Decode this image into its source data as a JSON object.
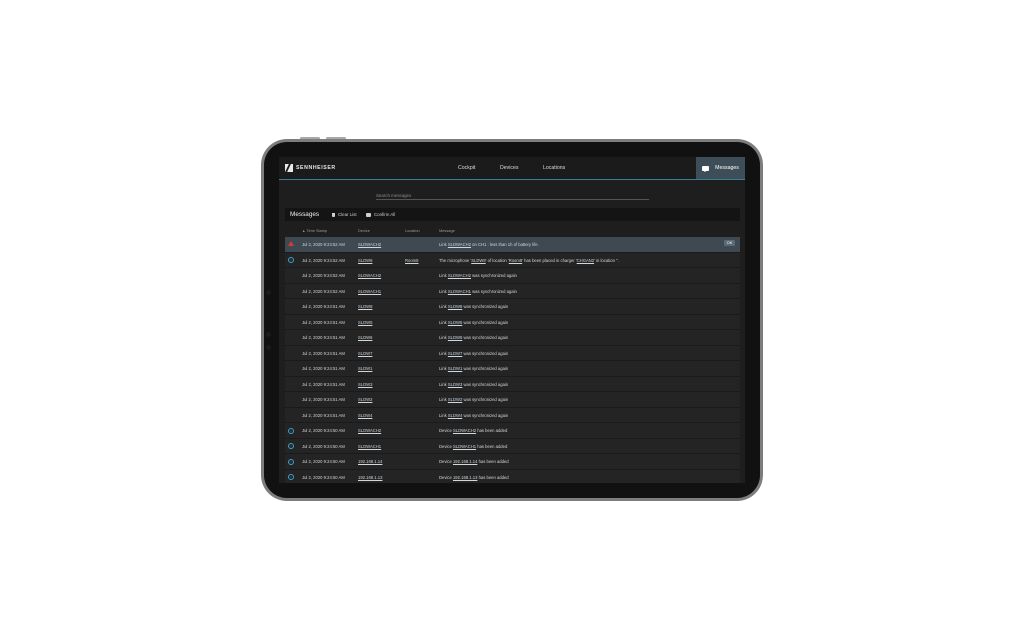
{
  "app": {
    "brand": "SENNHEISER",
    "nav": [
      "Cockpit",
      "Devices",
      "Locations"
    ],
    "messages_nav": "Messages"
  },
  "search": {
    "placeholder": "Search messages"
  },
  "panel": {
    "title": "Messages",
    "clear_label": "Clear List",
    "confirm_label": "Confirm All",
    "columns": {
      "timestamp": "Time Stamp",
      "device": "Device",
      "location": "Location",
      "message": "Message"
    },
    "ok_label": "OK"
  },
  "rows": [
    {
      "icon": "warning",
      "time": "Jul 2, 2020 9:24:52 AM",
      "device": "SLDWACH2",
      "location": "",
      "msg": [
        {
          "t": "Link "
        },
        {
          "t": "SLDWACH2",
          "link": true
        },
        {
          "t": " on CH1 : less than 1h of battery life."
        }
      ]
    },
    {
      "icon": "info",
      "time": "Jul 2, 2020 9:24:52 AM",
      "device": "SLDW8",
      "location": "Room8",
      "msg": [
        {
          "t": "The microphone '"
        },
        {
          "t": "SLDW8",
          "link": true
        },
        {
          "t": "' of location '"
        },
        {
          "t": "Room8",
          "link": true
        },
        {
          "t": "' has been placed in charger '"
        },
        {
          "t": "CHGAN2",
          "link": true
        },
        {
          "t": "' in location ''."
        }
      ]
    },
    {
      "icon": "",
      "time": "Jul 2, 2020 9:24:52 AM",
      "device": "SLDWACH2",
      "location": "",
      "msg": [
        {
          "t": "Link "
        },
        {
          "t": "SLDWACH2",
          "link": true
        },
        {
          "t": " was synchronized again"
        }
      ]
    },
    {
      "icon": "",
      "time": "Jul 2, 2020 9:24:52 AM",
      "device": "SLDWACH1",
      "location": "",
      "msg": [
        {
          "t": "Link "
        },
        {
          "t": "SLDWACH1",
          "link": true
        },
        {
          "t": " was synchronized again"
        }
      ]
    },
    {
      "icon": "",
      "time": "Jul 2, 2020 9:24:51 AM",
      "device": "SLDW8",
      "location": "",
      "msg": [
        {
          "t": "Link "
        },
        {
          "t": "SLDW8",
          "link": true
        },
        {
          "t": " was synchronized again"
        }
      ]
    },
    {
      "icon": "",
      "time": "Jul 2, 2020 9:24:51 AM",
      "device": "SLDW5",
      "location": "",
      "msg": [
        {
          "t": "Link "
        },
        {
          "t": "SLDW5",
          "link": true
        },
        {
          "t": " was synchronized again"
        }
      ]
    },
    {
      "icon": "",
      "time": "Jul 2, 2020 9:24:51 AM",
      "device": "SLDW6",
      "location": "",
      "msg": [
        {
          "t": "Link "
        },
        {
          "t": "SLDW6",
          "link": true
        },
        {
          "t": " was synchronized again"
        }
      ]
    },
    {
      "icon": "",
      "time": "Jul 2, 2020 9:24:51 AM",
      "device": "SLDW7",
      "location": "",
      "msg": [
        {
          "t": "Link "
        },
        {
          "t": "SLDW7",
          "link": true
        },
        {
          "t": " was synchronized again"
        }
      ]
    },
    {
      "icon": "",
      "time": "Jul 2, 2020 9:24:51 AM",
      "device": "SLDW1",
      "location": "",
      "msg": [
        {
          "t": "Link "
        },
        {
          "t": "SLDW1",
          "link": true
        },
        {
          "t": " was synchronized again"
        }
      ]
    },
    {
      "icon": "",
      "time": "Jul 2, 2020 9:24:51 AM",
      "device": "SLDW3",
      "location": "",
      "msg": [
        {
          "t": "Link "
        },
        {
          "t": "SLDW3",
          "link": true
        },
        {
          "t": " was synchronized again"
        }
      ]
    },
    {
      "icon": "",
      "time": "Jul 2, 2020 9:24:51 AM",
      "device": "SLDW2",
      "location": "",
      "msg": [
        {
          "t": "Link "
        },
        {
          "t": "SLDW2",
          "link": true
        },
        {
          "t": " was synchronized again"
        }
      ]
    },
    {
      "icon": "",
      "time": "Jul 2, 2020 9:24:51 AM",
      "device": "SLDW4",
      "location": "",
      "msg": [
        {
          "t": "Link "
        },
        {
          "t": "SLDW4",
          "link": true
        },
        {
          "t": " was synchronized again"
        }
      ]
    },
    {
      "icon": "info",
      "time": "Jul 2, 2020 9:24:50 AM",
      "device": "SLDWACH2",
      "location": "",
      "msg": [
        {
          "t": "Device "
        },
        {
          "t": "SLDWACH2",
          "link": true
        },
        {
          "t": " has been added"
        }
      ]
    },
    {
      "icon": "info",
      "time": "Jul 2, 2020 9:24:50 AM",
      "device": "SLDWACH1",
      "location": "",
      "msg": [
        {
          "t": "Device "
        },
        {
          "t": "SLDWACH1",
          "link": true
        },
        {
          "t": " has been added"
        }
      ]
    },
    {
      "icon": "info",
      "time": "Jul 2, 2020 9:24:50 AM",
      "device": "192.168.1.14",
      "location": "",
      "msg": [
        {
          "t": "Device "
        },
        {
          "t": "192.168.1.14",
          "link": true
        },
        {
          "t": " has been added"
        }
      ]
    },
    {
      "icon": "info",
      "time": "Jul 2, 2020 9:24:50 AM",
      "device": "192.168.1.13",
      "location": "",
      "msg": [
        {
          "t": "Device "
        },
        {
          "t": "192.168.1.13",
          "link": true
        },
        {
          "t": " has been added"
        }
      ]
    }
  ]
}
